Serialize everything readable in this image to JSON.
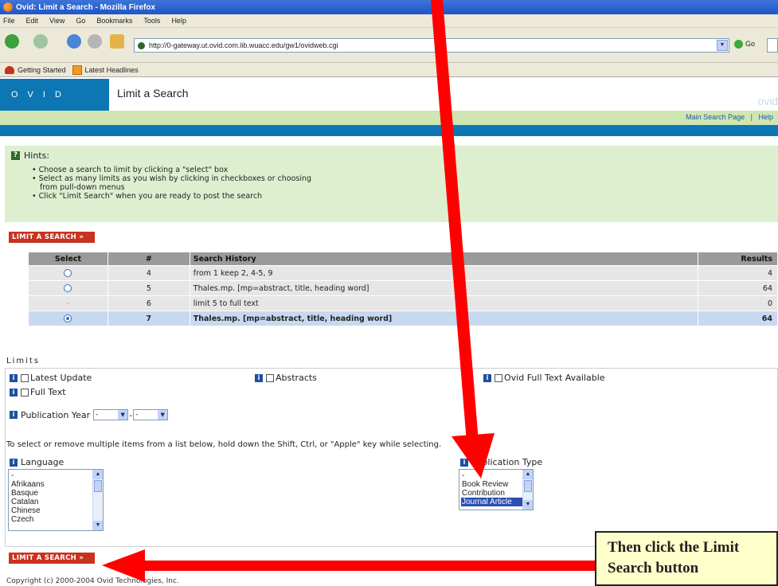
{
  "browser": {
    "window_title": "Ovid: Limit a Search - Mozilla Firefox",
    "menu": [
      "File",
      "Edit",
      "View",
      "Go",
      "Bookmarks",
      "Tools",
      "Help"
    ],
    "url": "http://0-gateway.ut.ovid.com.lib.wuacc.edu/gw1/ovidweb.cgi",
    "go_label": "Go",
    "bookmarks": [
      "Getting Started",
      "Latest Headlines"
    ]
  },
  "ovid": {
    "logo": "OVID",
    "page_title": "Limit a Search",
    "watermark": "ovid",
    "links": [
      "Main Search Page",
      "|",
      "Help"
    ]
  },
  "hints": {
    "title": "Hints:",
    "items": [
      "Choose a search to limit by clicking a \"select\" box",
      "Select as many limits as you wish by clicking in checkboxes or choosing",
      "from pull-down menus",
      "Click \"Limit Search\" when you are ready to post the search"
    ]
  },
  "limit_button_label": "LIMIT A SEARCH »",
  "history": {
    "headers": [
      "Select",
      "#",
      "Search History",
      "Results"
    ],
    "rows": [
      {
        "select": "radio",
        "num": "4",
        "text": "from 1 keep 2, 4-5, 9",
        "results": "4"
      },
      {
        "select": "radio",
        "num": "5",
        "text": "Thales.mp. [mp=abstract, title, heading word]",
        "results": "64"
      },
      {
        "select": "-",
        "num": "6",
        "text": "limit 5 to full text",
        "results": "0"
      },
      {
        "select": "radio-on",
        "num": "7",
        "text": "Thales.mp. [mp=abstract, title, heading word]",
        "results": "64"
      }
    ]
  },
  "limits": {
    "heading": "Limits",
    "latest_update": "Latest Update",
    "abstracts": "Abstracts",
    "ovid_full_text": "Ovid Full Text Available",
    "full_text": "Full Text",
    "pub_year_label": "Publication Year",
    "pub_year_from": "-",
    "pub_year_sep": "-",
    "pub_year_to": "-",
    "instruction": "To select or remove multiple items from a list below, hold down the Shift, Ctrl, or \"Apple\" key while selecting.",
    "language_label": "Language",
    "language_options": [
      "-",
      "Afrikaans",
      "Basque",
      "Catalan",
      "Chinese",
      "Czech"
    ],
    "pubtype_label": "Publication Type",
    "pubtype_options": [
      "-",
      "Book Review",
      "Contribution",
      "Journal Article"
    ],
    "pubtype_selected": "Journal Article"
  },
  "copyright": "Copyright (c) 2000-2004 Ovid Technologies, Inc.",
  "callout": {
    "line1": "Then click the Limit",
    "line2": "Search button"
  },
  "colors": {
    "ovid_blue": "#0d77b4",
    "arrow_red": "#ff0000",
    "button_red": "#c8321e",
    "hint_green": "#deefd0"
  }
}
